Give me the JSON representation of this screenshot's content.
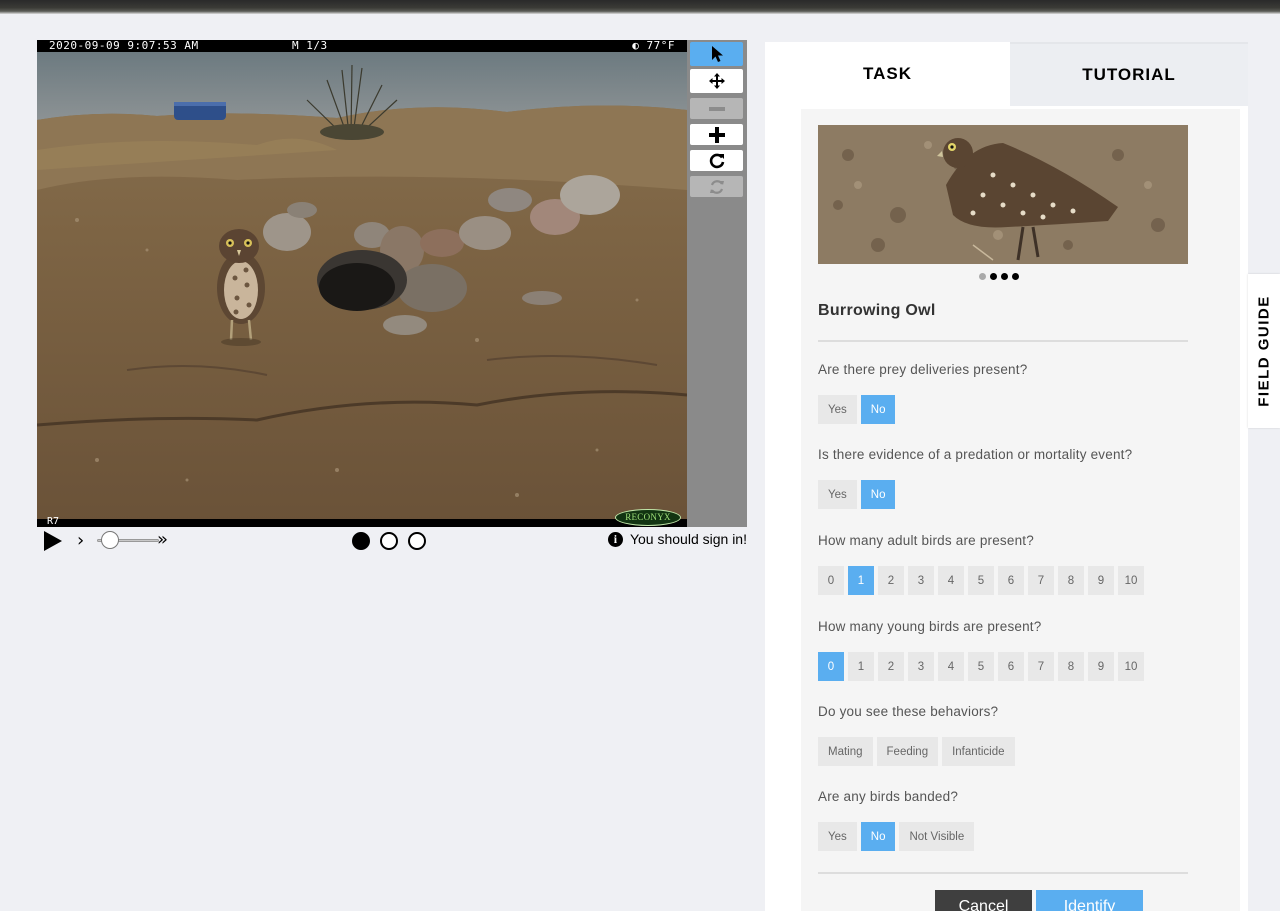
{
  "camera": {
    "timestamp": "2020-09-09 9:07:53 AM",
    "mode": "M 1/3",
    "temperature": "77°F",
    "camera_id": "R7",
    "brand": "RECONYX"
  },
  "toolbar": {
    "tools": [
      "pointer-icon",
      "move-icon",
      "zoom-out-icon",
      "zoom-in-icon",
      "rotate-icon",
      "reset-icon"
    ],
    "active": "pointer-icon",
    "disabled": [
      "zoom-out-icon",
      "reset-icon"
    ]
  },
  "controls": {
    "frames": 3,
    "current_frame": 1,
    "signin_text": "You should sign in!"
  },
  "tabs": {
    "task": "TASK",
    "tutorial": "TUTORIAL"
  },
  "species": {
    "name": "Burrowing Owl",
    "carousel_count": 4,
    "carousel_current": 1
  },
  "questions": [
    {
      "text": "Are there prey deliveries present?",
      "answers": [
        "Yes",
        "No"
      ],
      "selected": "No"
    },
    {
      "text": "Is there evidence of a predation or mortality event?",
      "answers": [
        "Yes",
        "No"
      ],
      "selected": "No"
    },
    {
      "text": "How many adult birds are present?",
      "answers": [
        "0",
        "1",
        "2",
        "3",
        "4",
        "5",
        "6",
        "7",
        "8",
        "9",
        "10"
      ],
      "selected": "1"
    },
    {
      "text": "How many young birds are present?",
      "answers": [
        "0",
        "1",
        "2",
        "3",
        "4",
        "5",
        "6",
        "7",
        "8",
        "9",
        "10"
      ],
      "selected": "0"
    },
    {
      "text": "Do you see these behaviors?",
      "answers": [
        "Mating",
        "Feeding",
        "Infanticide"
      ],
      "selected": ""
    },
    {
      "text": "Are any birds banded?",
      "answers": [
        "Yes",
        "No",
        "Not Visible"
      ],
      "selected": "No"
    }
  ],
  "buttons": {
    "cancel": "Cancel",
    "identify": "Identify"
  },
  "field_guide": "FIELD GUIDE",
  "colors": {
    "accent": "#5aaef0",
    "dark_button": "#3f3f3f",
    "panel_bg": "#f5f5f5",
    "page_bg": "#eff0f4"
  }
}
